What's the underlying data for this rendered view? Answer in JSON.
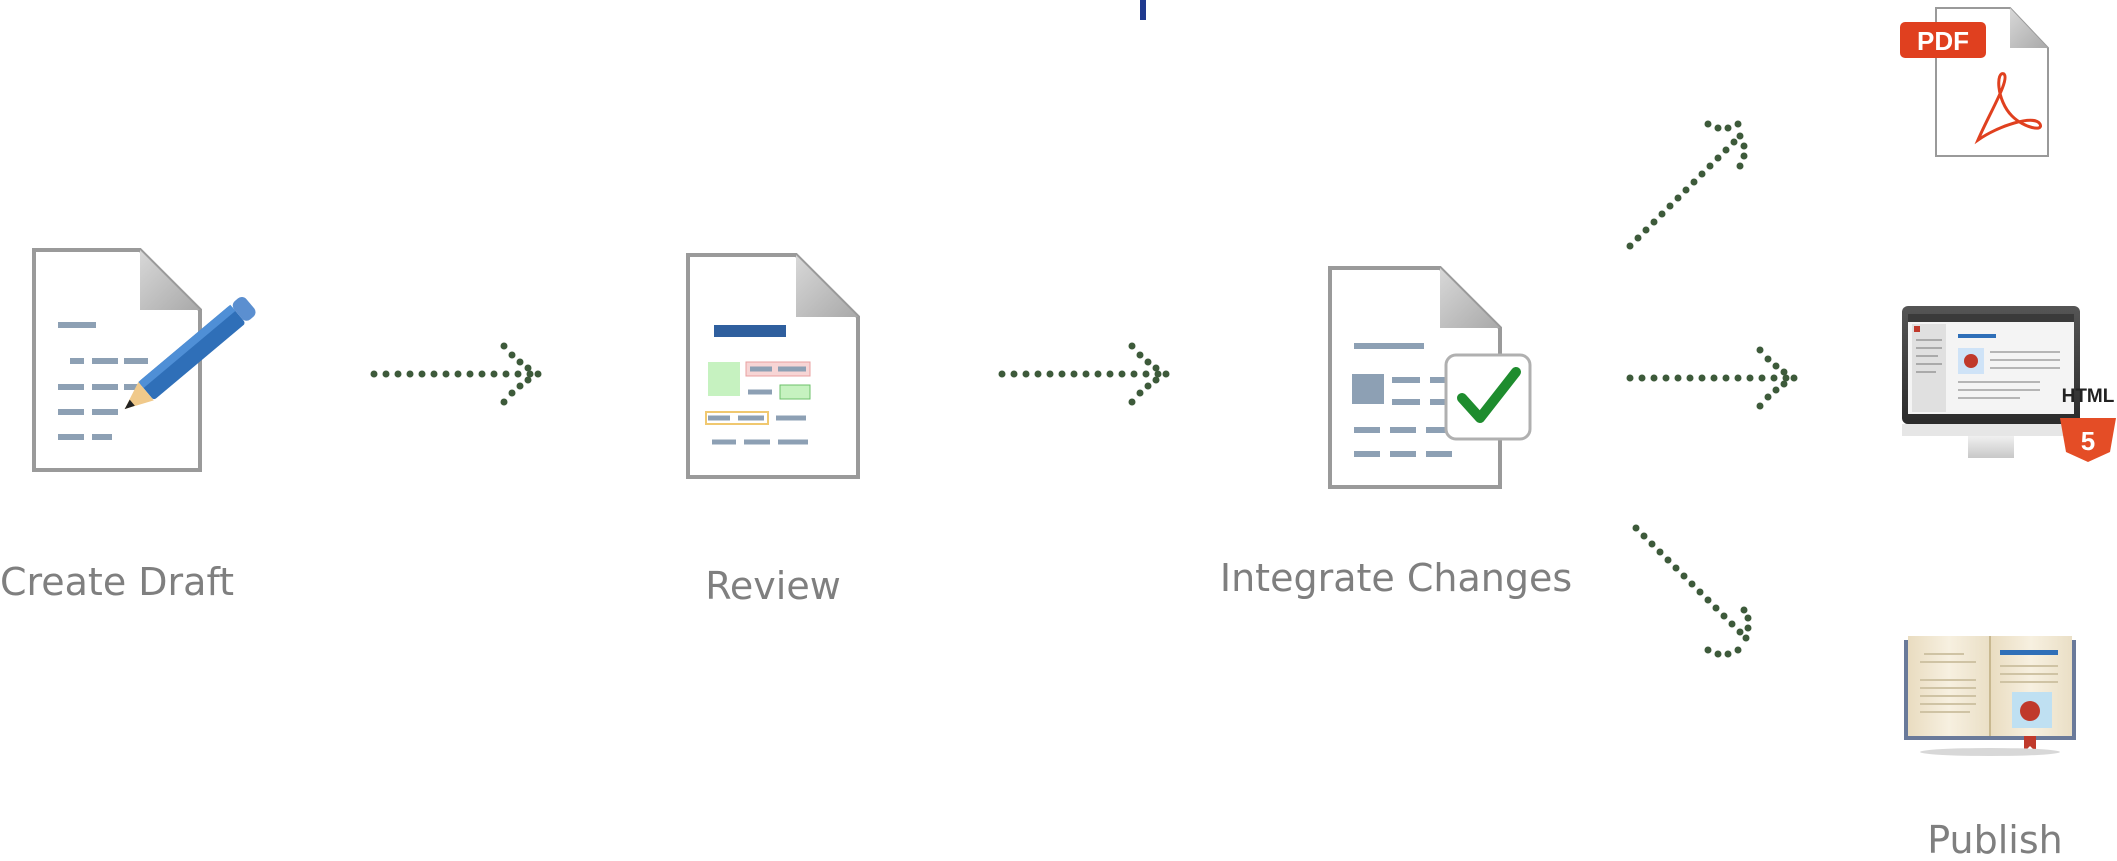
{
  "steps": [
    {
      "label": "Create Draft",
      "icon": "draft-document-pencil-icon"
    },
    {
      "label": "Review",
      "icon": "review-document-icon"
    },
    {
      "label": "Integrate Changes",
      "icon": "document-checkmark-icon"
    }
  ],
  "outputs": [
    {
      "icon": "pdf-file-icon",
      "text": "PDF"
    },
    {
      "icon": "html5-monitor-icon",
      "text": "HTML",
      "badge": "5"
    },
    {
      "icon": "open-book-icon"
    }
  ],
  "publish_label": "Publish",
  "colors": {
    "label": "#7f7f7f",
    "arrow_dots": "#3d5a3a",
    "doc_outline": "#9a9a9a",
    "doc_lines": "#8da0b4",
    "pdf_red": "#e0401f",
    "html_orange": "#e44d26",
    "check_green": "#1e8c2e",
    "pencil_blue": "#2f6fb8"
  }
}
